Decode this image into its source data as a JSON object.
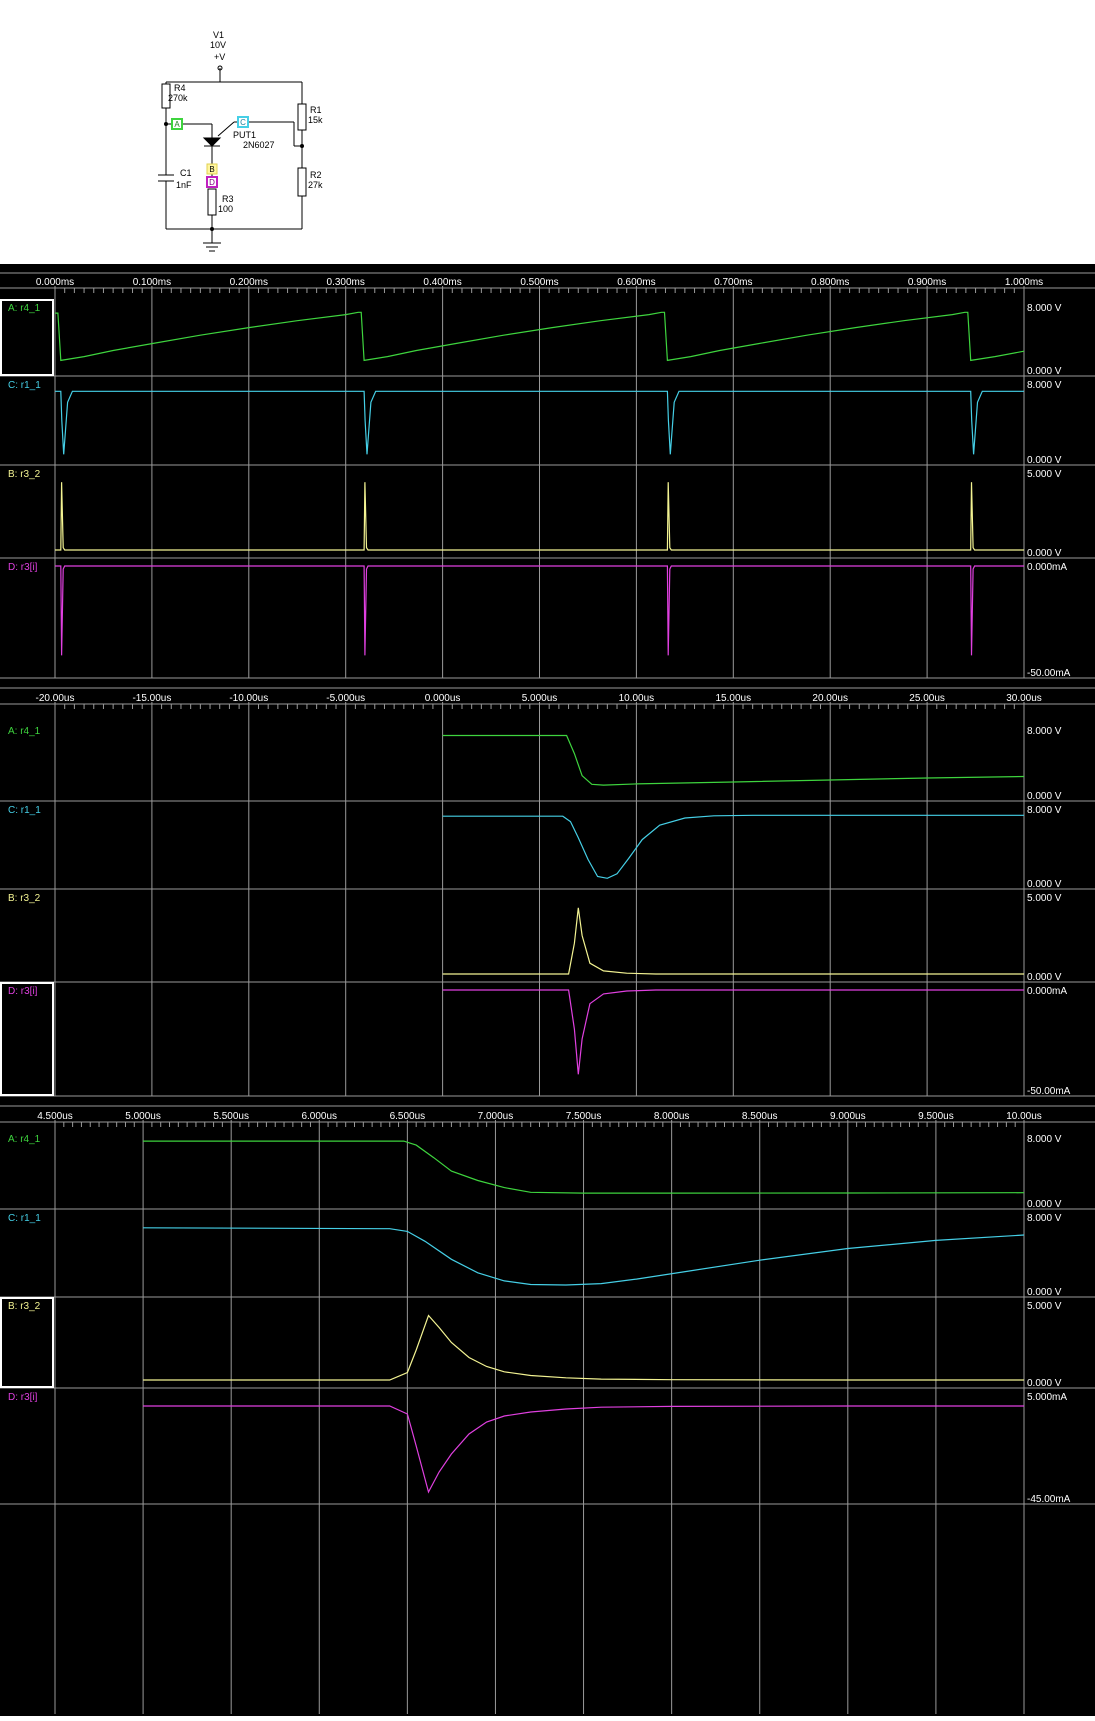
{
  "schematic": {
    "v1": {
      "name": "V1",
      "value": "10V",
      "pin": "+V"
    },
    "r4": {
      "name": "R4",
      "value": "270k"
    },
    "r1": {
      "name": "R1",
      "value": "15k"
    },
    "r2": {
      "name": "R2",
      "value": "27k"
    },
    "r3": {
      "name": "R3",
      "value": "100"
    },
    "c1": {
      "name": "C1",
      "value": "1nF"
    },
    "put": {
      "name": "PUT1",
      "model": "2N6027"
    },
    "probes": {
      "a": "A",
      "b": "B",
      "c": "C",
      "d": "D"
    }
  },
  "colors": {
    "background": "#000000",
    "grid": "#9a9a9a",
    "text": "#ffffff",
    "trace_a": "#3ed43e",
    "trace_c": "#45cfe6",
    "trace_b": "#f3f392",
    "trace_d": "#e040e0"
  },
  "chart_data": [
    {
      "type": "line",
      "name": "panel-1",
      "time_unit": "ms",
      "x_ticks": [
        "0.000ms",
        "0.100ms",
        "0.200ms",
        "0.300ms",
        "0.400ms",
        "0.500ms",
        "0.600ms",
        "0.700ms",
        "0.800ms",
        "0.900ms",
        "1.000ms"
      ],
      "xlim": [
        0,
        1.0
      ],
      "traces": [
        {
          "label": "A: r4_1",
          "color_key": "trace_a",
          "top_label": "8.000 V",
          "bottom_label": "0.000 V",
          "ylim": [
            0,
            8
          ],
          "x": [
            0.0,
            0.003,
            0.006,
            0.03,
            0.06,
            0.1,
            0.15,
            0.2,
            0.25,
            0.3,
            0.313,
            0.316,
            0.319,
            0.343,
            0.373,
            0.413,
            0.463,
            0.513,
            0.563,
            0.613,
            0.626,
            0.629,
            0.632,
            0.656,
            0.686,
            0.726,
            0.776,
            0.826,
            0.876,
            0.926,
            0.939,
            0.942,
            0.945,
            0.97,
            1.0
          ],
          "y": [
            7.2,
            7.2,
            1.0,
            1.5,
            2.3,
            3.2,
            4.3,
            5.3,
            6.2,
            7.0,
            7.3,
            7.3,
            1.0,
            1.5,
            2.3,
            3.2,
            4.3,
            5.3,
            6.2,
            7.0,
            7.3,
            7.3,
            1.0,
            1.5,
            2.3,
            3.2,
            4.3,
            5.3,
            6.2,
            7.0,
            7.3,
            7.3,
            1.0,
            1.5,
            2.2
          ]
        },
        {
          "label": "C: r1_1",
          "color_key": "trace_c",
          "top_label": "8.000 V",
          "bottom_label": "0.000 V",
          "ylim": [
            0,
            8
          ],
          "x": [
            0.0,
            0.006,
            0.007,
            0.009,
            0.013,
            0.018,
            0.316,
            0.319,
            0.32,
            0.322,
            0.326,
            0.331,
            0.629,
            0.632,
            0.633,
            0.635,
            0.639,
            0.644,
            0.942,
            0.945,
            0.946,
            0.948,
            0.952,
            0.957,
            1.0
          ],
          "y": [
            7.2,
            7.2,
            4.0,
            0.3,
            6.0,
            7.2,
            7.2,
            7.2,
            4.0,
            0.3,
            6.0,
            7.2,
            7.2,
            7.2,
            4.0,
            0.3,
            6.0,
            7.2,
            7.2,
            7.2,
            4.0,
            0.3,
            6.0,
            7.2,
            7.2
          ]
        },
        {
          "label": "B: r3_2",
          "color_key": "trace_b",
          "top_label": "5.000 V",
          "bottom_label": "0.000 V",
          "ylim": [
            0,
            5
          ],
          "x": [
            0.0,
            0.006,
            0.0068,
            0.0085,
            0.01,
            0.319,
            0.3198,
            0.3215,
            0.323,
            0.632,
            0.6328,
            0.6345,
            0.636,
            0.945,
            0.9458,
            0.9475,
            0.949,
            1.0
          ],
          "y": [
            0,
            0,
            4.4,
            0.15,
            0,
            0,
            4.4,
            0.15,
            0,
            0,
            4.4,
            0.15,
            0,
            0,
            4.4,
            0.15,
            0,
            0
          ]
        },
        {
          "label": "D: r3[i]",
          "color_key": "trace_d",
          "top_label": "0.000mA",
          "bottom_label": "-50.00mA",
          "ylim": [
            -50,
            0
          ],
          "x": [
            0.0,
            0.006,
            0.0068,
            0.0085,
            0.01,
            0.319,
            0.3198,
            0.3215,
            0.323,
            0.632,
            0.6328,
            0.6345,
            0.636,
            0.945,
            0.9458,
            0.9475,
            0.949,
            1.0
          ],
          "y": [
            0,
            0,
            -43,
            -1.5,
            0,
            0,
            -43,
            -1.5,
            0,
            0,
            -43,
            -1.5,
            0,
            0,
            -43,
            -1.5,
            0,
            0
          ]
        }
      ]
    },
    {
      "type": "line",
      "name": "panel-2",
      "time_unit": "us",
      "x_ticks": [
        "-20.00us",
        "-15.00us",
        "-10.00us",
        "-5.000us",
        "0.000us",
        "5.000us",
        "10.00us",
        "15.00us",
        "20.00us",
        "25.00us",
        "30.00us"
      ],
      "xlim": [
        -20,
        30
      ],
      "traces": [
        {
          "label": "A: r4_1",
          "color_key": "trace_a",
          "top_label": "8.000 V",
          "bottom_label": "0.000 V",
          "ylim": [
            0,
            8
          ],
          "x": [
            0,
            6.4,
            6.8,
            7.2,
            7.7,
            8.3,
            10,
            15,
            20,
            25,
            30
          ],
          "y": [
            7.3,
            7.3,
            5.0,
            2.2,
            1.1,
            1.0,
            1.15,
            1.4,
            1.65,
            1.9,
            2.1
          ]
        },
        {
          "label": "C: r1_1",
          "color_key": "trace_c",
          "top_label": "8.000 V",
          "bottom_label": "0.000 V",
          "ylim": [
            0,
            8
          ],
          "x": [
            0,
            6.2,
            6.6,
            7.0,
            7.5,
            8.0,
            8.5,
            9.0,
            9.6,
            10.3,
            11.2,
            12.5,
            14.0,
            16.0,
            20,
            25,
            30
          ],
          "y": [
            7.2,
            7.2,
            6.6,
            4.8,
            2.4,
            0.5,
            0.3,
            0.8,
            2.5,
            4.6,
            6.2,
            7.0,
            7.25,
            7.3,
            7.3,
            7.3,
            7.3
          ]
        },
        {
          "label": "B: r3_2",
          "color_key": "trace_b",
          "top_label": "5.000 V",
          "bottom_label": "0.000 V",
          "ylim": [
            0,
            5
          ],
          "x": [
            0,
            6.5,
            6.8,
            7.0,
            7.2,
            7.6,
            8.3,
            9.5,
            11,
            30
          ],
          "y": [
            0,
            0,
            2.0,
            4.3,
            2.5,
            0.7,
            0.2,
            0.05,
            0,
            0
          ]
        },
        {
          "label": "D: r3[i]",
          "color_key": "trace_d",
          "top_label": "0.000mA",
          "bottom_label": "-50.00mA",
          "ylim": [
            -50,
            0
          ],
          "x": [
            0,
            6.5,
            6.8,
            7.0,
            7.2,
            7.6,
            8.3,
            9.5,
            11,
            30
          ],
          "y": [
            0,
            0,
            -20,
            -43,
            -25,
            -7,
            -2,
            -0.5,
            0,
            0
          ]
        }
      ]
    },
    {
      "type": "line",
      "name": "panel-3",
      "time_unit": "us",
      "x_ticks": [
        "4.500us",
        "5.000us",
        "5.500us",
        "6.000us",
        "6.500us",
        "7.000us",
        "7.500us",
        "8.000us",
        "8.500us",
        "9.000us",
        "9.500us",
        "10.00us"
      ],
      "xlim": [
        4.5,
        10.0
      ],
      "traces": [
        {
          "label": "A: r4_1",
          "color_key": "trace_a",
          "top_label": "8.000 V",
          "bottom_label": "0.000 V",
          "ylim": [
            0,
            8
          ],
          "x": [
            5.0,
            6.48,
            6.55,
            6.65,
            6.75,
            6.9,
            7.05,
            7.2,
            7.5,
            8.0,
            9.0,
            10.0
          ],
          "y": [
            7.6,
            7.6,
            7.1,
            5.5,
            3.8,
            2.6,
            1.7,
            1.1,
            1.0,
            1.0,
            1.02,
            1.05
          ]
        },
        {
          "label": "C: r1_1",
          "color_key": "trace_c",
          "top_label": "8.000 V",
          "bottom_label": "0.000 V",
          "ylim": [
            0,
            8
          ],
          "x": [
            5.0,
            6.4,
            6.5,
            6.6,
            6.75,
            6.9,
            7.05,
            7.2,
            7.4,
            7.6,
            7.8,
            8.1,
            8.5,
            9.0,
            9.5,
            10.0
          ],
          "y": [
            6.8,
            6.7,
            6.4,
            5.3,
            3.3,
            1.8,
            0.9,
            0.5,
            0.45,
            0.6,
            1.1,
            2.0,
            3.2,
            4.5,
            5.4,
            6.0
          ]
        },
        {
          "label": "B: r3_2",
          "color_key": "trace_b",
          "top_label": "5.000 V",
          "bottom_label": "0.000 V",
          "ylim": [
            0,
            5
          ],
          "x": [
            5.0,
            6.4,
            6.5,
            6.55,
            6.62,
            6.68,
            6.75,
            6.85,
            6.95,
            7.05,
            7.2,
            7.4,
            7.6,
            8.0,
            9.0,
            10.0
          ],
          "y": [
            0,
            0,
            0.5,
            2.0,
            4.3,
            3.5,
            2.5,
            1.5,
            0.9,
            0.55,
            0.3,
            0.15,
            0.06,
            0.02,
            0,
            0
          ]
        },
        {
          "label": "D: r3[i]",
          "color_key": "trace_d",
          "top_label": "5.000mA",
          "bottom_label": "-45.00mA",
          "ylim": [
            -45,
            5
          ],
          "x": [
            5.0,
            6.4,
            6.5,
            6.55,
            6.62,
            6.68,
            6.75,
            6.85,
            6.95,
            7.05,
            7.2,
            7.4,
            7.6,
            8.0,
            9.0,
            10.0
          ],
          "y": [
            0,
            0,
            -4,
            -20,
            -43,
            -33,
            -24,
            -14,
            -8,
            -5,
            -3,
            -1.5,
            -0.6,
            -0.2,
            0,
            0
          ]
        }
      ]
    }
  ]
}
